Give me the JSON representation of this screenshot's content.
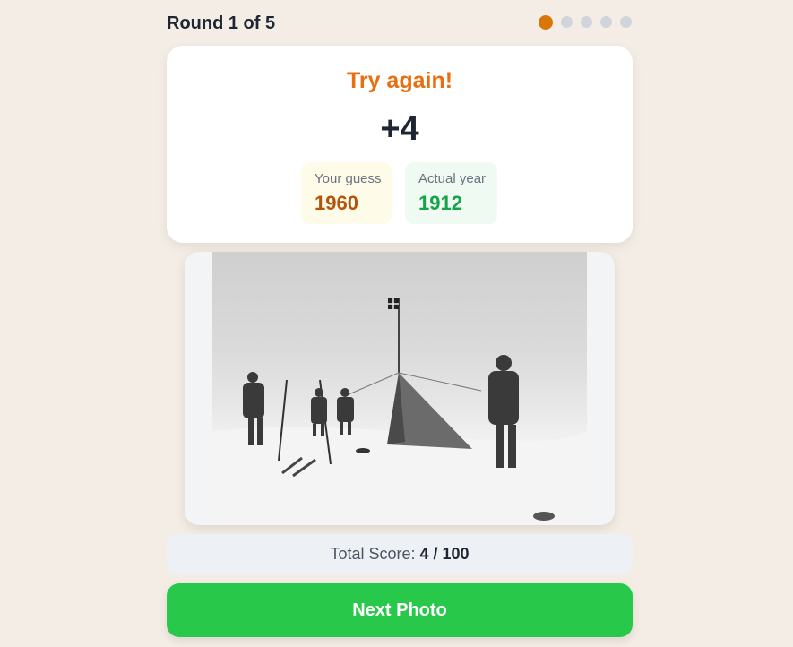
{
  "header": {
    "round_label": "Round 1 of 5",
    "progress": {
      "current": 1,
      "total": 5
    }
  },
  "result": {
    "title": "Try again!",
    "points": "+4",
    "guess_label": "Your guess",
    "guess_value": "1960",
    "actual_label": "Actual year",
    "actual_value": "1912"
  },
  "score": {
    "label": "Total Score:",
    "value": "4 / 100"
  },
  "next_button_label": "Next Photo",
  "colors": {
    "accent": "#d97706",
    "result_title": "#ea6d10",
    "guess": "#b45309",
    "actual": "#16a34a",
    "button": "#28c94a"
  }
}
